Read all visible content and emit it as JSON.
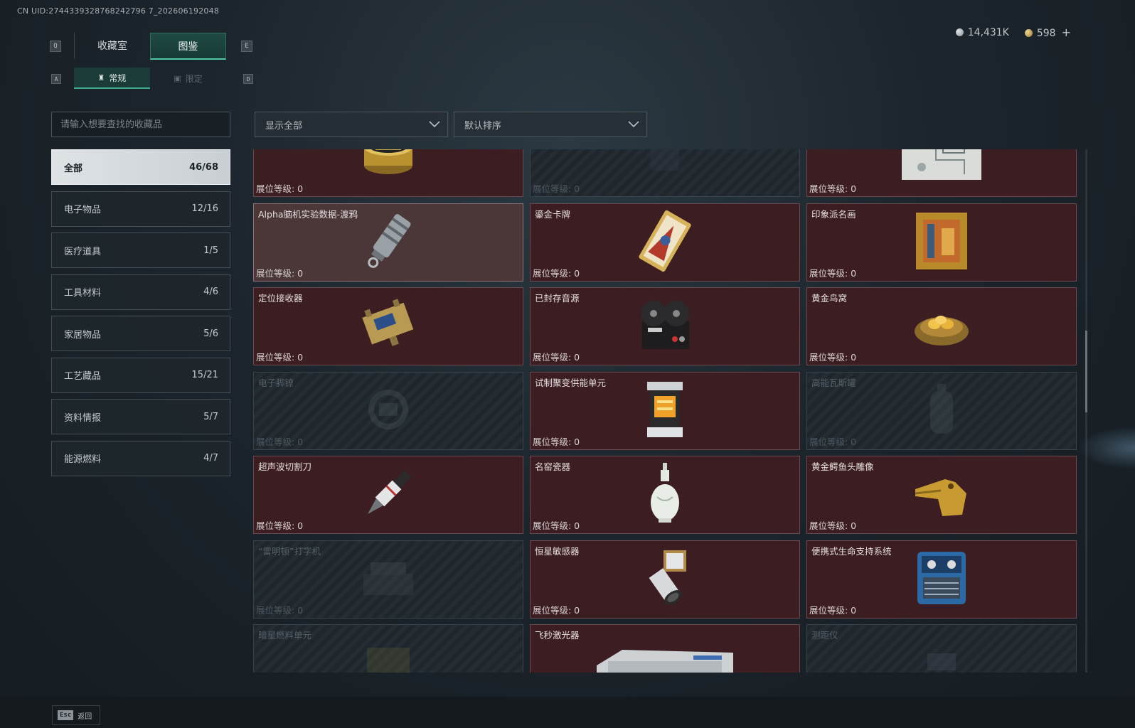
{
  "uid": "CN UID:2744339328768242796 7_202606192048",
  "currency": {
    "silver": "14,431K",
    "gold": "598",
    "plus": "+"
  },
  "keyhints": {
    "prev_tab": "Q",
    "next_tab": "E",
    "prev_sub": "A",
    "next_sub": "D"
  },
  "tabs": [
    {
      "label": "收藏室"
    },
    {
      "label": "图鉴"
    }
  ],
  "subtabs": [
    {
      "icon": "♜",
      "label": "常规"
    },
    {
      "icon": "▣",
      "label": "限定"
    }
  ],
  "search": {
    "placeholder": "请输入想要查找的收藏品"
  },
  "filters": {
    "show": "显示全部",
    "sort": "默认排序"
  },
  "categories": [
    {
      "label": "全部",
      "count": "46/68"
    },
    {
      "label": "电子物品",
      "count": "12/16"
    },
    {
      "label": "医疗道具",
      "count": "1/5"
    },
    {
      "label": "工具材料",
      "count": "4/6"
    },
    {
      "label": "家居物品",
      "count": "5/6"
    },
    {
      "label": "工艺藏品",
      "count": "15/21"
    },
    {
      "label": "资料情报",
      "count": "5/7"
    },
    {
      "label": "能源燃料",
      "count": "4/7"
    }
  ],
  "level_prefix": "展位等级: ",
  "items": [
    {
      "name": "",
      "level": "0",
      "state": "owned",
      "icon": "caviar-tin"
    },
    {
      "name": "",
      "level": "0",
      "state": "locked",
      "icon": "blank"
    },
    {
      "name": "",
      "level": "0",
      "state": "owned",
      "icon": "map-blueprint"
    },
    {
      "name": "Alpha脑机实验数据-渡鸦",
      "level": "0",
      "state": "highlight",
      "icon": "data-capsule"
    },
    {
      "name": "鎏金卡牌",
      "level": "0",
      "state": "owned",
      "icon": "gilded-card"
    },
    {
      "name": "印象派名画",
      "level": "0",
      "state": "owned",
      "icon": "framed-painting"
    },
    {
      "name": "定位接收器",
      "level": "0",
      "state": "owned",
      "icon": "receiver"
    },
    {
      "name": "已封存音源",
      "level": "0",
      "state": "owned",
      "icon": "reel-recorder"
    },
    {
      "name": "黄金鸟窝",
      "level": "0",
      "state": "owned",
      "icon": "golden-nest"
    },
    {
      "name": "电子脚镣",
      "level": "0",
      "state": "locked",
      "icon": "shackle"
    },
    {
      "name": "试制聚变供能单元",
      "level": "0",
      "state": "owned",
      "icon": "fusion-cell"
    },
    {
      "name": "高能瓦斯罐",
      "level": "0",
      "state": "locked",
      "icon": "gas-tank"
    },
    {
      "name": "超声波切割刀",
      "level": "0",
      "state": "owned",
      "icon": "ultrasonic-knife"
    },
    {
      "name": "名窑瓷器",
      "level": "0",
      "state": "owned",
      "icon": "porcelain-vase"
    },
    {
      "name": "黄金鳄鱼头雕像",
      "level": "0",
      "state": "owned",
      "icon": "croc-statue"
    },
    {
      "name": "“雷明顿”打字机",
      "level": "0",
      "state": "locked",
      "icon": "typewriter"
    },
    {
      "name": "恒星敏感器",
      "level": "0",
      "state": "owned",
      "icon": "star-sensor"
    },
    {
      "name": "便携式生命支持系统",
      "level": "0",
      "state": "owned",
      "icon": "life-support"
    },
    {
      "name": "暗星燃料单元",
      "level": "",
      "state": "locked",
      "icon": "fuel-unit"
    },
    {
      "name": "飞秒激光器",
      "level": "",
      "state": "owned",
      "icon": "laser-device"
    },
    {
      "name": "测距仪",
      "level": "",
      "state": "locked",
      "icon": "rangefinder"
    }
  ],
  "back": {
    "key": "Esc",
    "label": "返回"
  },
  "colors": {
    "accent": "#4cc9a0",
    "owned_card": "#3c1d22",
    "highlight_card": "#4b3638",
    "locked_card": "#1f272d"
  }
}
